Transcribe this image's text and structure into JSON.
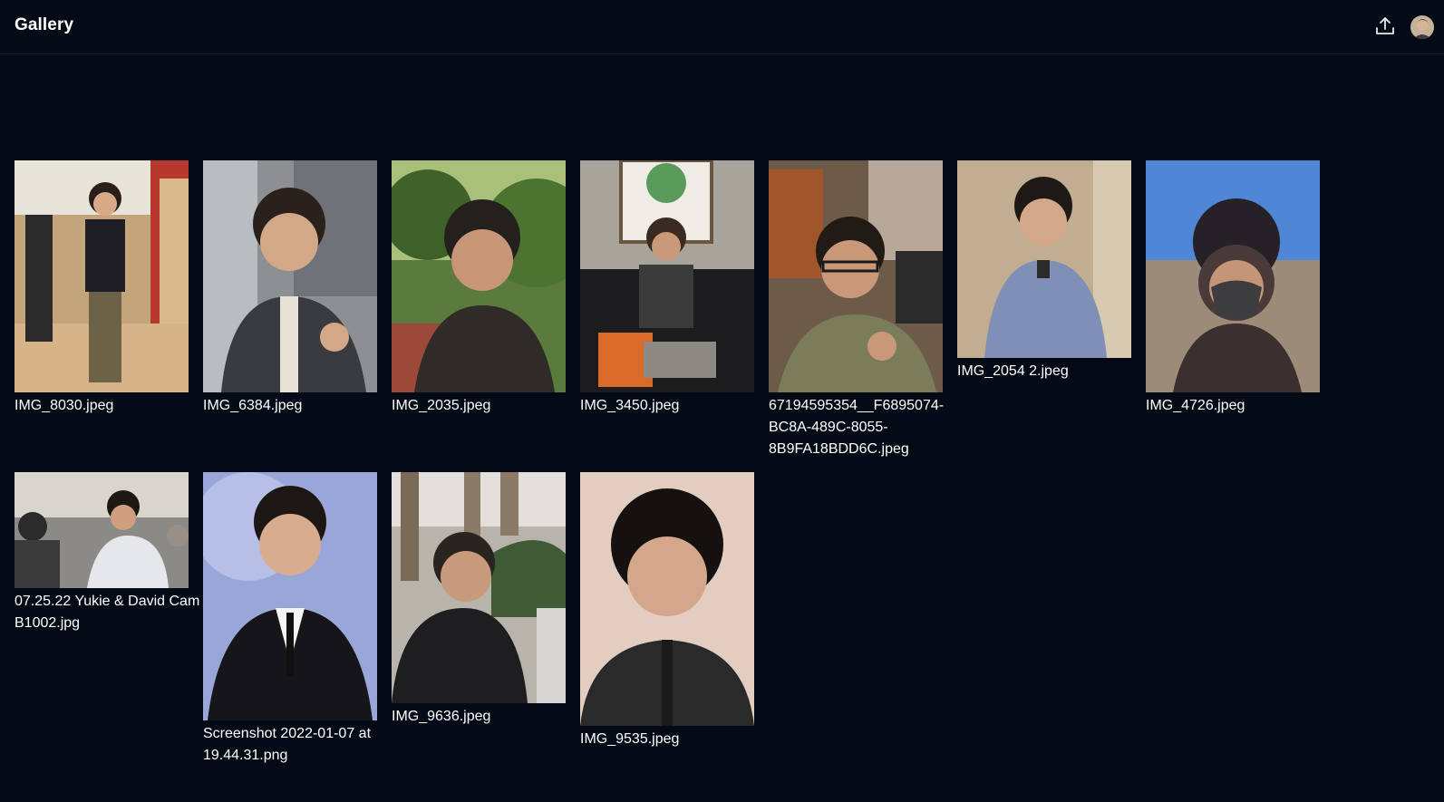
{
  "header": {
    "title": "Gallery",
    "upload_icon": "upload-icon",
    "avatar_icon": "user-avatar"
  },
  "gallery": {
    "items": [
      {
        "filename": "IMG_8030.jpeg"
      },
      {
        "filename": "IMG_6384.jpeg"
      },
      {
        "filename": "IMG_2035.jpeg"
      },
      {
        "filename": "IMG_3450.jpeg"
      },
      {
        "filename": "67194595354__F6895074-BC8A-489C-8055-8B9FA18BDD6C.jpeg"
      },
      {
        "filename": "IMG_2054 2.jpeg"
      },
      {
        "filename": "IMG_4726.jpeg"
      },
      {
        "filename": "07.25.22 Yukie & David Cam B1002.jpg"
      },
      {
        "filename": "Screenshot 2022-01-07 at 19.44.31.png"
      },
      {
        "filename": "IMG_9636.jpeg"
      },
      {
        "filename": "IMG_9535.jpeg"
      }
    ]
  },
  "colors": {
    "background": "#050b16",
    "text": "#ffffff",
    "divider": "#1b2230"
  }
}
